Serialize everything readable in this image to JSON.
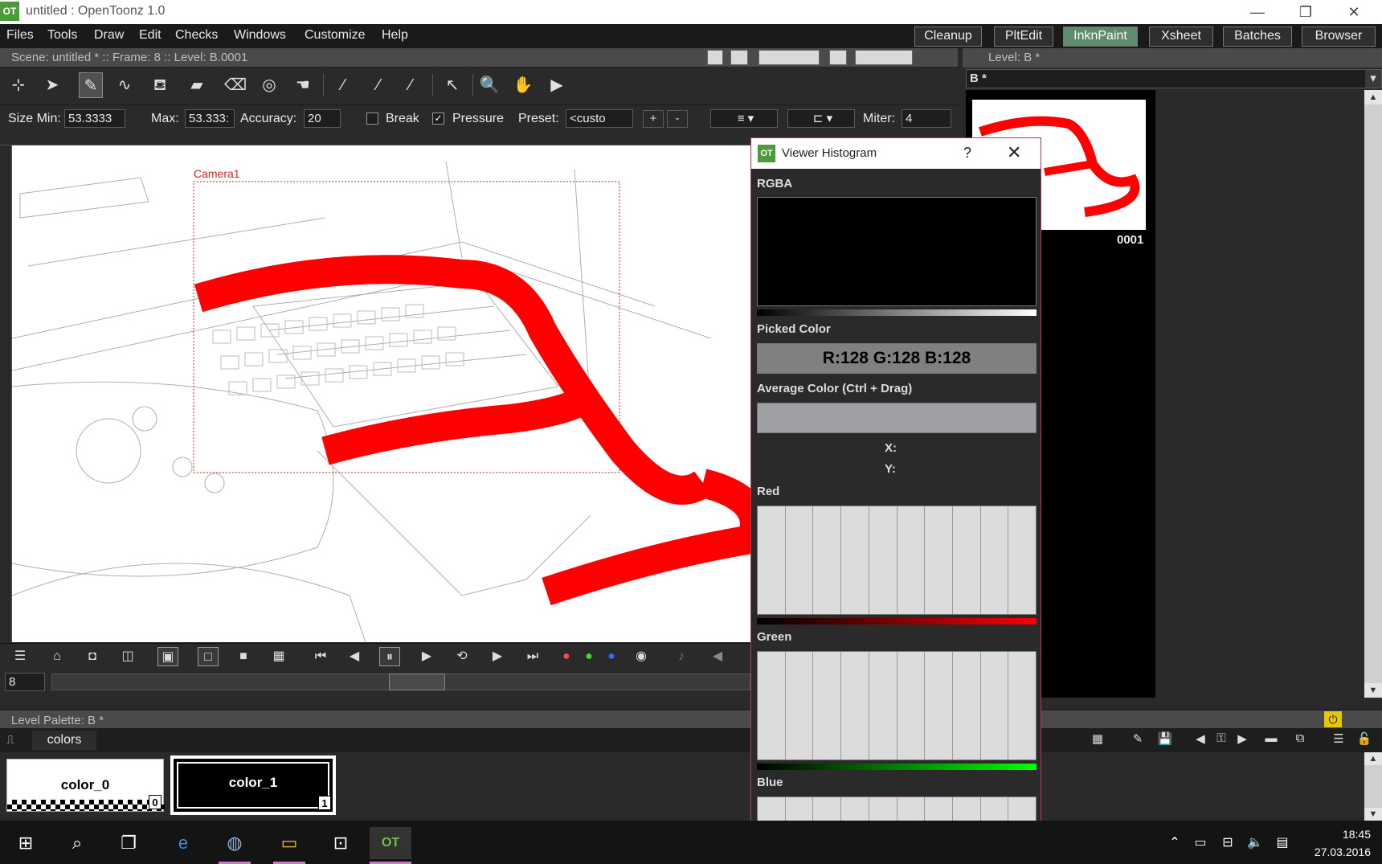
{
  "window": {
    "title": "untitled : OpenToonz 1.0",
    "logo_text": "OT",
    "minimize": "—",
    "restore": "❐",
    "close": "✕"
  },
  "menu": {
    "items": [
      "Files",
      "Tools",
      "Draw",
      "Edit",
      "Checks",
      "Windows",
      "Customize",
      "Help"
    ],
    "rooms": [
      "Cleanup",
      "PltEdit",
      "InknPaint",
      "Xsheet",
      "Batches",
      "Browser"
    ],
    "active_room": "InknPaint"
  },
  "scene_bar": {
    "text": "Scene: untitled *  ::  Frame: 8  ::  Level: B.0001"
  },
  "level_header": {
    "text": "Level:  B *",
    "field_value": "B *"
  },
  "tool_options": {
    "size_min_label": "Size Min:",
    "size_min_value": "53.3333",
    "max_label": "Max:",
    "max_value": "53.333:",
    "accuracy_label": "Accuracy:",
    "accuracy_value": "20",
    "break_label": "Break",
    "break_checked": false,
    "pressure_label": "Pressure",
    "pressure_checked": true,
    "preset_label": "Preset:",
    "preset_value": "<custo",
    "add_label": "+",
    "remove_label": "-",
    "miter_label": "Miter:",
    "miter_value": "4"
  },
  "viewer": {
    "camera_label": "Camera1",
    "stroke_color": "#ff0000"
  },
  "frame_bar": {
    "frame": "8"
  },
  "level_strip": {
    "frame_label": "0001"
  },
  "palette": {
    "header": "Level Palette: B *",
    "page_tab": "colors",
    "styles": [
      {
        "name": "color_0",
        "index": "0",
        "selected": false
      },
      {
        "name": "color_1",
        "index": "1",
        "selected": true
      }
    ]
  },
  "histogram": {
    "title": "Viewer Histogram",
    "help": "?",
    "close": "✕",
    "rgba_label": "RGBA",
    "picked_label": "Picked Color",
    "picked_value": "R:128 G:128 B:128",
    "average_label": "Average Color (Ctrl + Drag)",
    "x_label": "X:",
    "y_label": "Y:",
    "red_label": "Red",
    "green_label": "Green",
    "blue_label": "Blue"
  },
  "taskbar": {
    "time": "18:45",
    "date": "27.03.2016"
  }
}
